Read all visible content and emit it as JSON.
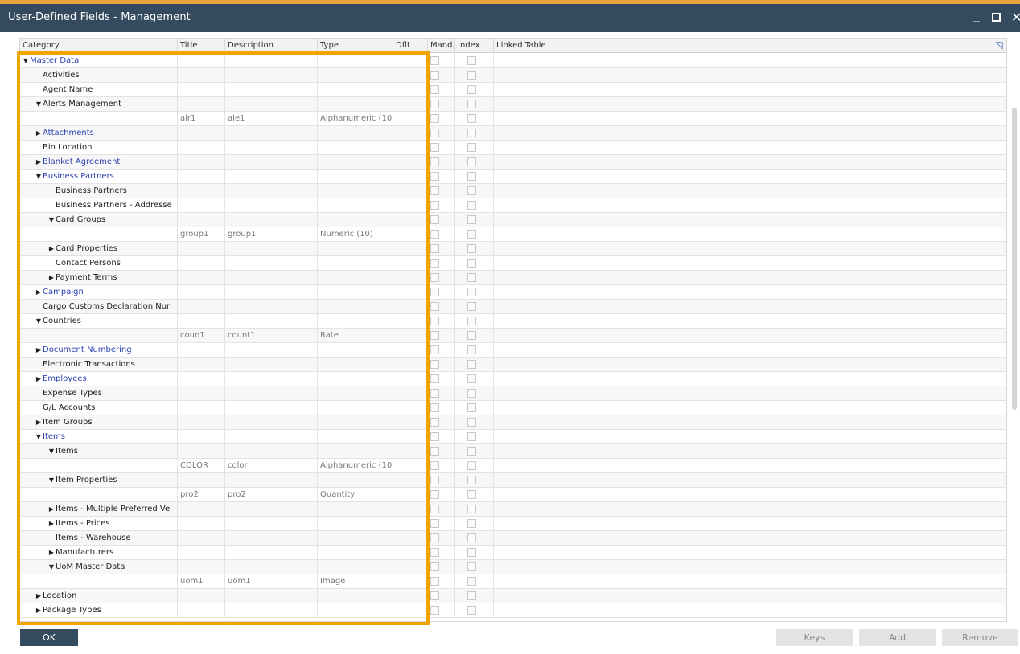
{
  "window": {
    "title": "User-Defined Fields - Management",
    "minimize_glyph": "_",
    "close_glyph": "✕"
  },
  "columns": [
    "Category",
    "Title",
    "Description",
    "Type",
    "Dflt",
    "Mand.",
    "Index",
    "Linked Table"
  ],
  "rows": [
    {
      "label": "Master Data",
      "level": 0,
      "toggle": "open",
      "link": true
    },
    {
      "label": "Activities",
      "level": 1,
      "toggle": "none",
      "link": false
    },
    {
      "label": "Agent Name",
      "level": 1,
      "toggle": "none",
      "link": false
    },
    {
      "label": "Alerts Management",
      "level": 1,
      "toggle": "open",
      "link": false
    },
    {
      "label": "",
      "title": "alr1",
      "description": "ale1",
      "type": "Alphanumeric (10"
    },
    {
      "label": "Attachments",
      "level": 1,
      "toggle": "closed",
      "link": true
    },
    {
      "label": "Bin Location",
      "level": 1,
      "toggle": "none",
      "link": false
    },
    {
      "label": "Blanket Agreement",
      "level": 1,
      "toggle": "closed",
      "link": true
    },
    {
      "label": "Business Partners",
      "level": 1,
      "toggle": "open",
      "link": true
    },
    {
      "label": "Business Partners",
      "level": 2,
      "toggle": "none",
      "link": false
    },
    {
      "label": "Business Partners - Addresse",
      "level": 2,
      "toggle": "none",
      "link": false
    },
    {
      "label": "Card Groups",
      "level": 2,
      "toggle": "open",
      "link": false
    },
    {
      "label": "",
      "title": "group1",
      "description": "group1",
      "type": "Numeric (10)"
    },
    {
      "label": "Card Properties",
      "level": 2,
      "toggle": "closed",
      "link": false
    },
    {
      "label": "Contact Persons",
      "level": 2,
      "toggle": "none",
      "link": false
    },
    {
      "label": "Payment Terms",
      "level": 2,
      "toggle": "closed",
      "link": false
    },
    {
      "label": "Campaign",
      "level": 1,
      "toggle": "closed",
      "link": true
    },
    {
      "label": "Cargo Customs Declaration Nur",
      "level": 1,
      "toggle": "none",
      "link": false
    },
    {
      "label": "Countries",
      "level": 1,
      "toggle": "open",
      "link": false
    },
    {
      "label": "",
      "title": "coun1",
      "description": "count1",
      "type": "Rate"
    },
    {
      "label": "Document Numbering",
      "level": 1,
      "toggle": "closed",
      "link": true
    },
    {
      "label": "Electronic Transactions",
      "level": 1,
      "toggle": "none",
      "link": false
    },
    {
      "label": "Employees",
      "level": 1,
      "toggle": "closed",
      "link": true
    },
    {
      "label": "Expense Types",
      "level": 1,
      "toggle": "none",
      "link": false
    },
    {
      "label": "G/L Accounts",
      "level": 1,
      "toggle": "none",
      "link": false
    },
    {
      "label": "Item Groups",
      "level": 1,
      "toggle": "closed",
      "link": false
    },
    {
      "label": "Items",
      "level": 1,
      "toggle": "open",
      "link": true
    },
    {
      "label": "Items",
      "level": 2,
      "toggle": "open",
      "link": false
    },
    {
      "label": "",
      "title": "COLOR",
      "description": "color",
      "type": "Alphanumeric (10"
    },
    {
      "label": "Item Properties",
      "level": 2,
      "toggle": "open",
      "link": false
    },
    {
      "label": "",
      "title": "pro2",
      "description": "pro2",
      "type": "Quantity"
    },
    {
      "label": "Items - Multiple Preferred Ve",
      "level": 2,
      "toggle": "closed",
      "link": false
    },
    {
      "label": "Items - Prices",
      "level": 2,
      "toggle": "closed",
      "link": false
    },
    {
      "label": "Items - Warehouse",
      "level": 2,
      "toggle": "none",
      "link": false
    },
    {
      "label": "Manufacturers",
      "level": 2,
      "toggle": "closed",
      "link": false
    },
    {
      "label": "UoM Master Data",
      "level": 2,
      "toggle": "open",
      "link": false
    },
    {
      "label": "",
      "title": "uom1",
      "description": "uom1",
      "type": "Image"
    },
    {
      "label": "Location",
      "level": 1,
      "toggle": "closed",
      "link": false
    },
    {
      "label": "Package Types",
      "level": 1,
      "toggle": "closed",
      "link": false
    }
  ],
  "buttons": {
    "ok": "OK",
    "keys": "Keys",
    "add": "Add",
    "remove": "Remove"
  },
  "colors": {
    "titlebar": "#344a5e",
    "accent": "#e7a33e",
    "highlight": "#f0a500",
    "link": "#2a3fb0"
  },
  "icons": {
    "expand": "expand-corner-icon",
    "open": "triangle-down-icon",
    "closed": "triangle-right-icon"
  }
}
